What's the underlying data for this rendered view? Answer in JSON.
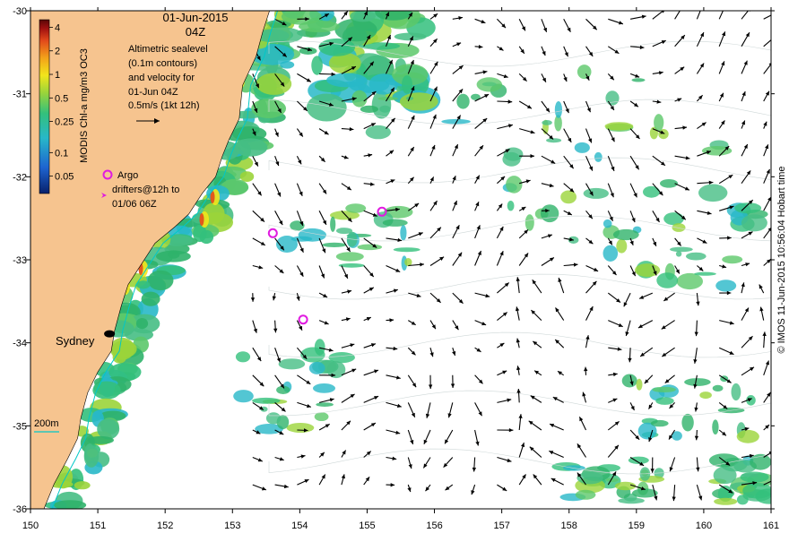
{
  "title": {
    "date": "01-Jun-2015",
    "hour": "04Z"
  },
  "colorbar": {
    "label": "MODIS Chl-a mg/m3 OC3",
    "ticks": [
      "4",
      "2",
      "1",
      "0.5",
      "0.25",
      "0.1",
      "0.05"
    ],
    "tick_values": [
      4,
      2,
      1,
      0.5,
      0.25,
      0.1,
      0.05
    ],
    "min_value": 0.03,
    "max_value": 5,
    "scale": "log",
    "colors": [
      "#08206b",
      "#1e64d0",
      "#28b8c8",
      "#33c07c",
      "#9bd43a",
      "#f2e51b",
      "#f3a21a",
      "#e2491b",
      "#a01010",
      "#5a0606"
    ]
  },
  "legend": {
    "line1": "Altimetric sealevel",
    "line2": "(0.1m contours)",
    "line3": "and velocity for",
    "line4": "01-Jun 04Z",
    "line5": "0.5m/s (1kt 12h)",
    "argo_label": "Argo",
    "drifter_line1": "drifters@12h to",
    "drifter_line2": "01/06 06Z",
    "isobath_label": "200m"
  },
  "places": {
    "sydney": "Sydney"
  },
  "credit": "© IMOS 11-Jun-2015 10:56:04 Hobart time",
  "axes": {
    "x_ticks": [
      "150",
      "151",
      "152",
      "153",
      "154",
      "155",
      "156",
      "157",
      "158",
      "159",
      "160",
      "161"
    ],
    "y_ticks": [
      "-30",
      "-31",
      "-32",
      "-33",
      "-34",
      "-35",
      "-36"
    ],
    "xlim": [
      150,
      161
    ],
    "ylim": [
      -36,
      -30
    ]
  },
  "colors": {
    "land": "#f6c48f",
    "ocean": "#ffffff",
    "coast_green": "#2fb36a",
    "arrow": "#000000",
    "argo_marker": "#e01be0",
    "isobath": "#00c8c8"
  },
  "argo_floats": [
    {
      "lon": 155.22,
      "lat": -32.42
    },
    {
      "lon": 153.6,
      "lat": -32.68
    },
    {
      "lon": 154.05,
      "lat": -33.72
    }
  ],
  "sydney_lonlat": {
    "lon": 151.2,
    "lat": -33.87
  }
}
